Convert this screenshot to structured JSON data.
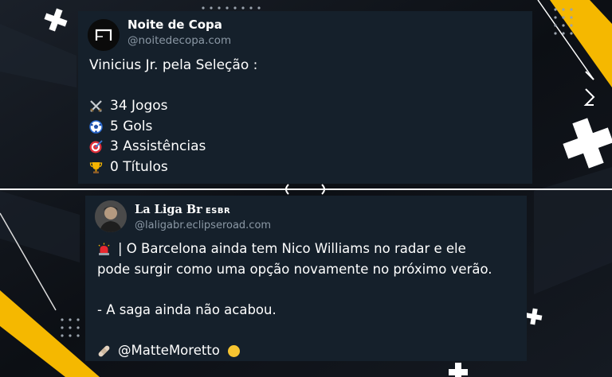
{
  "tweets": [
    {
      "author": "Noite de Copa",
      "handle": "@noitedecopa.com",
      "intro": "Vinicius Jr. pela Seleção :",
      "stats": [
        {
          "icon": "crossed-swords-icon",
          "text": "34 Jogos"
        },
        {
          "icon": "soccer-ball-icon",
          "text": "5 Gols"
        },
        {
          "icon": "direct-hit-icon",
          "text": "3 Assistências"
        },
        {
          "icon": "trophy-icon",
          "text": "0 Títulos"
        }
      ]
    },
    {
      "author": "La Liga Br",
      "tag": "ESBR",
      "handle": "@laligabr.eclipseroad.com",
      "line1": "| O Barcelona ainda tem Nico Williams no radar e ele",
      "line2": "pode surgir como uma opção novamente no próximo verão.",
      "line3": "- A saga ainda não acabou.",
      "credit": "@MatteMoretto",
      "icons": [
        "siren-icon",
        "bandage-icon",
        "yellow-circle-icon"
      ]
    }
  ],
  "colors": {
    "card_bg": "#15202b",
    "handle": "#8b98a5",
    "accent_yellow": "#f5b800",
    "background": "#0e1116"
  }
}
